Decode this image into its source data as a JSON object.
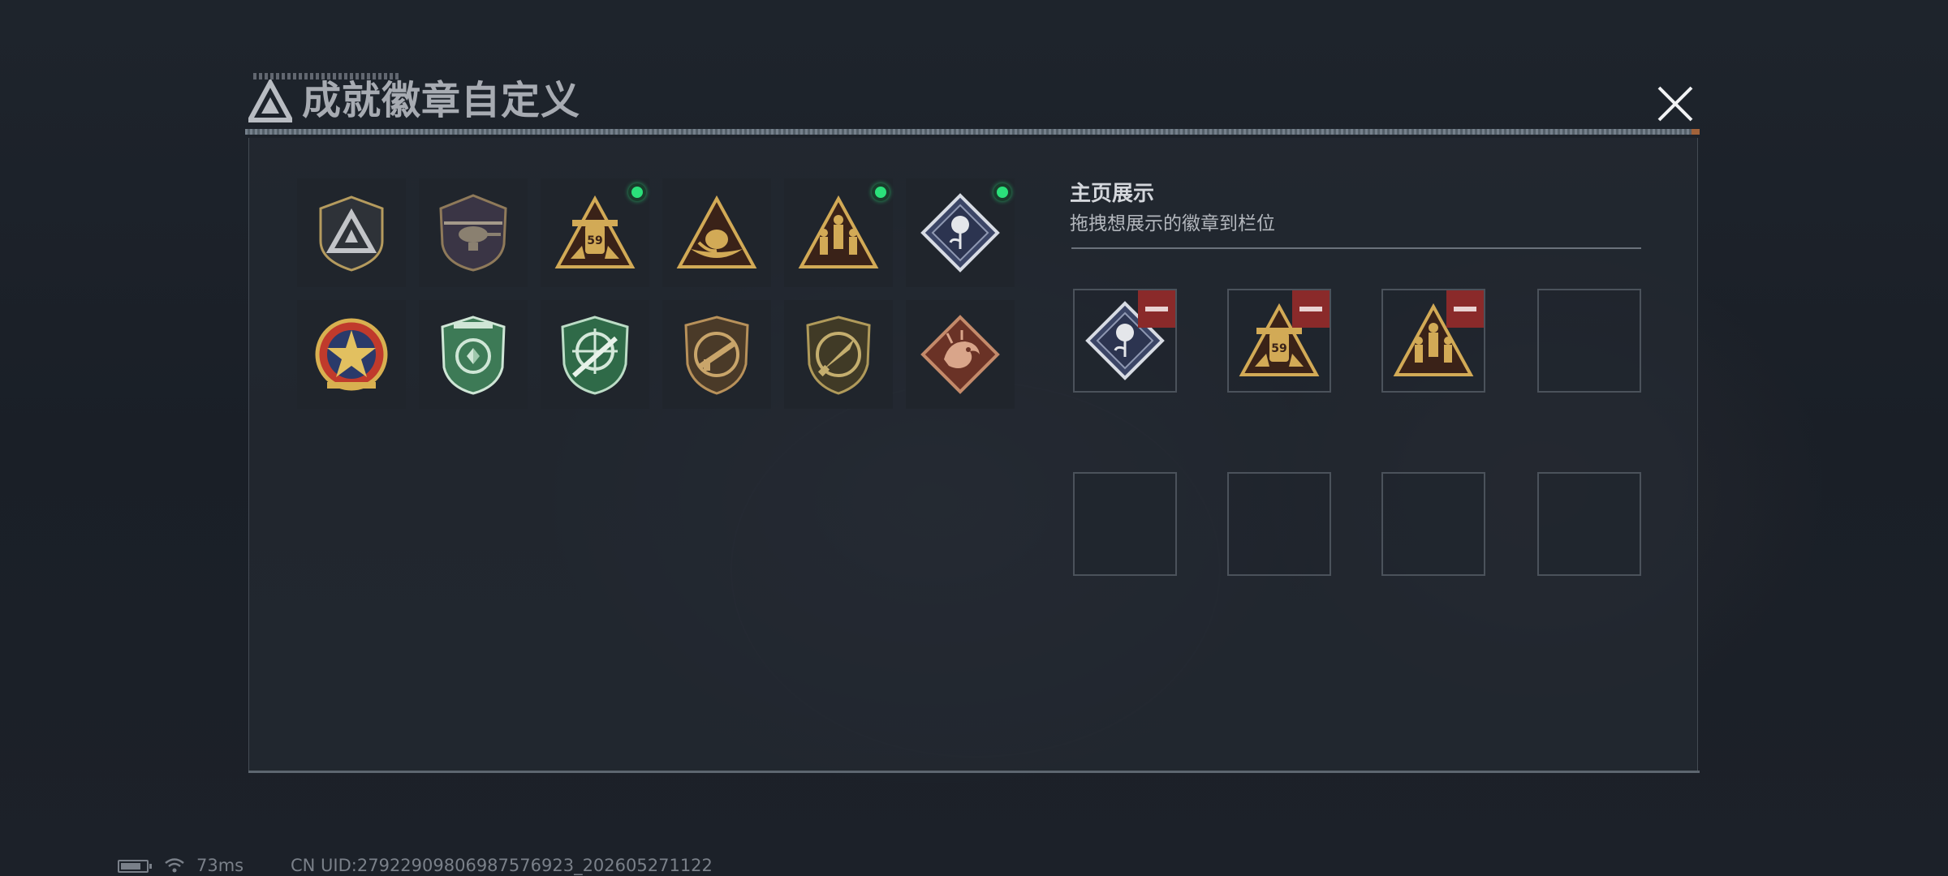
{
  "header": {
    "title": "成就徽章自定义",
    "logo_icon": "triangle-a-logo-icon",
    "close_icon": "close-icon"
  },
  "collection": {
    "badges": [
      {
        "icon": "triangle-shield-badge-icon",
        "equipped": false
      },
      {
        "icon": "helicopter-shield-badge-icon",
        "equipped": false
      },
      {
        "icon": "gold-triangle-59-badge-icon",
        "equipped": true
      },
      {
        "icon": "gold-triangle-hands-badge-icon",
        "equipped": false
      },
      {
        "icon": "gold-triangle-soldiers-badge-icon",
        "equipped": true
      },
      {
        "icon": "rose-diamond-badge-icon",
        "equipped": true
      },
      {
        "icon": "red-star-medal-badge-icon",
        "equipped": false
      },
      {
        "icon": "green-shield-arrows-badge-icon",
        "equipped": false
      },
      {
        "icon": "green-crosshair-rifle-badge-icon",
        "equipped": false
      },
      {
        "icon": "bronze-rifle-shield-badge-icon",
        "equipped": false
      },
      {
        "icon": "bronze-knife-shield-badge-icon",
        "equipped": false
      },
      {
        "icon": "dragon-diamond-badge-icon",
        "equipped": false
      }
    ]
  },
  "showcase": {
    "title": "主页展示",
    "subtitle": "拖拽想展示的徽章到栏位",
    "slots": [
      {
        "icon": "rose-diamond-badge-icon",
        "filled": true
      },
      {
        "icon": "gold-triangle-59-badge-icon",
        "filled": true
      },
      {
        "icon": "gold-triangle-soldiers-badge-icon",
        "filled": true
      },
      {
        "icon": "",
        "filled": false
      },
      {
        "icon": "",
        "filled": false
      },
      {
        "icon": "",
        "filled": false
      },
      {
        "icon": "",
        "filled": false
      },
      {
        "icon": "",
        "filled": false
      }
    ]
  },
  "status_bar": {
    "ping": "73ms",
    "uid": "CN UID:27922909806987576923_202605271122",
    "battery_icon": "battery-icon",
    "wifi_icon": "wifi-icon"
  },
  "colors": {
    "equipped_dot": "#2be07a",
    "remove_button": "#8a2a2a",
    "gold": "#c9a24e",
    "panel_bg": "#242a32"
  }
}
